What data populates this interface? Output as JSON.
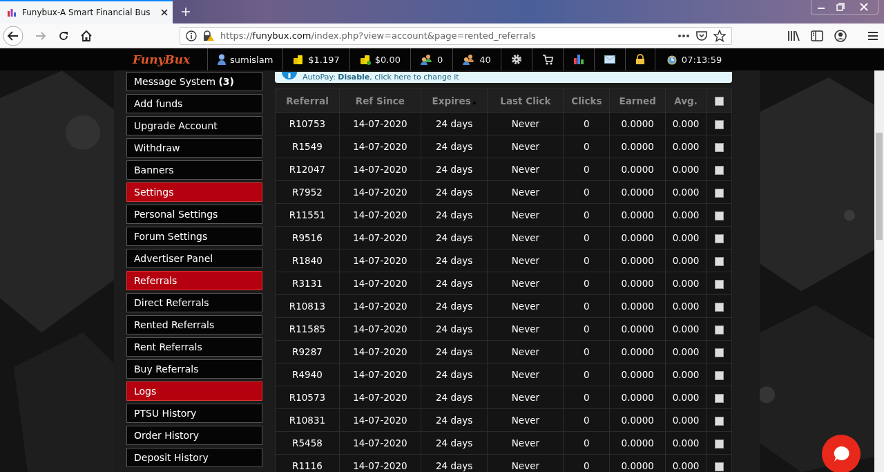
{
  "browser": {
    "tab_title": "Funybux-A Smart Financial Bus",
    "url_prefix": "https://",
    "url_host": "funybux.com",
    "url_path": "/index.php?view=account&page=rented_referrals"
  },
  "nav": {
    "logo": "FunyBux",
    "username": "sumislam",
    "balance": "$1.197",
    "purchase_balance": "$0.00",
    "direct_referrals": "0",
    "rented_referrals": "40",
    "clock": "07:13:59"
  },
  "sidebar": [
    {
      "label": "Message System **(3)**",
      "kind": "link"
    },
    {
      "label": "Add funds",
      "kind": "link"
    },
    {
      "label": "Upgrade Account",
      "kind": "link"
    },
    {
      "label": "Withdraw",
      "kind": "link"
    },
    {
      "label": "Banners",
      "kind": "link"
    },
    {
      "label": "Settings",
      "kind": "section"
    },
    {
      "label": "Personal Settings",
      "kind": "link"
    },
    {
      "label": "Forum Settings",
      "kind": "link"
    },
    {
      "label": "Advertiser Panel",
      "kind": "link"
    },
    {
      "label": "Referrals",
      "kind": "section"
    },
    {
      "label": "Direct Referrals",
      "kind": "link"
    },
    {
      "label": "Rented Referrals",
      "kind": "link"
    },
    {
      "label": "Rent Referrals",
      "kind": "link"
    },
    {
      "label": "Buy Referrals",
      "kind": "link"
    },
    {
      "label": "Logs",
      "kind": "section"
    },
    {
      "label": "PTSU History",
      "kind": "link"
    },
    {
      "label": "Order History",
      "kind": "link"
    },
    {
      "label": "Deposit History",
      "kind": "link"
    }
  ],
  "notice": {
    "text": "AutoPay: **Disable**, click here to change it"
  },
  "table": {
    "columns": [
      {
        "label": "Referral",
        "sorted": false
      },
      {
        "label": "Ref Since",
        "sorted": false
      },
      {
        "label": "Expires",
        "sorted": true
      },
      {
        "label": "Last Click",
        "sorted": false
      },
      {
        "label": "Clicks",
        "sorted": false
      },
      {
        "label": "Earned",
        "sorted": false
      },
      {
        "label": "Avg.",
        "sorted": false
      }
    ],
    "select_all_checked": false,
    "rows": [
      {
        "referral": "R10753",
        "ref_since": "14-07-2020",
        "expires": "24 days",
        "last_click": "Never",
        "clicks": "0",
        "earned": "0.0000",
        "avg": "0.000",
        "checked": false
      },
      {
        "referral": "R1549",
        "ref_since": "14-07-2020",
        "expires": "24 days",
        "last_click": "Never",
        "clicks": "0",
        "earned": "0.0000",
        "avg": "0.000",
        "checked": false
      },
      {
        "referral": "R12047",
        "ref_since": "14-07-2020",
        "expires": "24 days",
        "last_click": "Never",
        "clicks": "0",
        "earned": "0.0000",
        "avg": "0.000",
        "checked": false
      },
      {
        "referral": "R7952",
        "ref_since": "14-07-2020",
        "expires": "24 days",
        "last_click": "Never",
        "clicks": "0",
        "earned": "0.0000",
        "avg": "0.000",
        "checked": false
      },
      {
        "referral": "R11551",
        "ref_since": "14-07-2020",
        "expires": "24 days",
        "last_click": "Never",
        "clicks": "0",
        "earned": "0.0000",
        "avg": "0.000",
        "checked": false
      },
      {
        "referral": "R9516",
        "ref_since": "14-07-2020",
        "expires": "24 days",
        "last_click": "Never",
        "clicks": "0",
        "earned": "0.0000",
        "avg": "0.000",
        "checked": false
      },
      {
        "referral": "R1840",
        "ref_since": "14-07-2020",
        "expires": "24 days",
        "last_click": "Never",
        "clicks": "0",
        "earned": "0.0000",
        "avg": "0.000",
        "checked": false
      },
      {
        "referral": "R3131",
        "ref_since": "14-07-2020",
        "expires": "24 days",
        "last_click": "Never",
        "clicks": "0",
        "earned": "0.0000",
        "avg": "0.000",
        "checked": false
      },
      {
        "referral": "R10813",
        "ref_since": "14-07-2020",
        "expires": "24 days",
        "last_click": "Never",
        "clicks": "0",
        "earned": "0.0000",
        "avg": "0.000",
        "checked": false
      },
      {
        "referral": "R11585",
        "ref_since": "14-07-2020",
        "expires": "24 days",
        "last_click": "Never",
        "clicks": "0",
        "earned": "0.0000",
        "avg": "0.000",
        "checked": false
      },
      {
        "referral": "R9287",
        "ref_since": "14-07-2020",
        "expires": "24 days",
        "last_click": "Never",
        "clicks": "0",
        "earned": "0.0000",
        "avg": "0.000",
        "checked": false
      },
      {
        "referral": "R4940",
        "ref_since": "14-07-2020",
        "expires": "24 days",
        "last_click": "Never",
        "clicks": "0",
        "earned": "0.0000",
        "avg": "0.000",
        "checked": false
      },
      {
        "referral": "R10573",
        "ref_since": "14-07-2020",
        "expires": "24 days",
        "last_click": "Never",
        "clicks": "0",
        "earned": "0.0000",
        "avg": "0.000",
        "checked": false
      },
      {
        "referral": "R10831",
        "ref_since": "14-07-2020",
        "expires": "24 days",
        "last_click": "Never",
        "clicks": "0",
        "earned": "0.0000",
        "avg": "0.000",
        "checked": false
      },
      {
        "referral": "R5458",
        "ref_since": "14-07-2020",
        "expires": "24 days",
        "last_click": "Never",
        "clicks": "0",
        "earned": "0.0000",
        "avg": "0.000",
        "checked": false
      },
      {
        "referral": "R1116",
        "ref_since": "14-07-2020",
        "expires": "24 days",
        "last_click": "Never",
        "clicks": "0",
        "earned": "0.0000",
        "avg": "0.000",
        "checked": false
      }
    ]
  }
}
